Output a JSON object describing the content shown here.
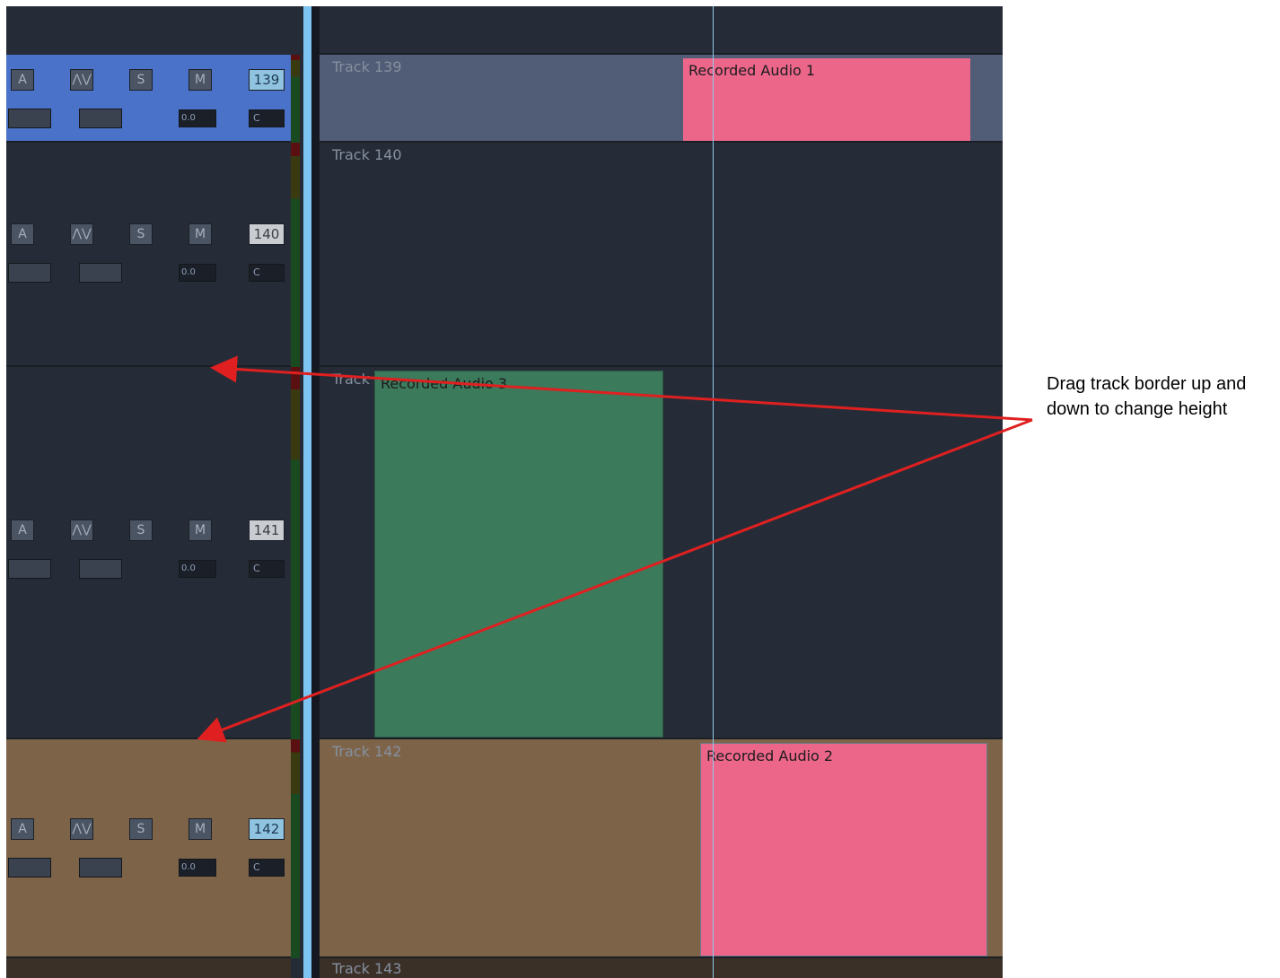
{
  "tracks": [
    {
      "number": "139",
      "label": "Track 139",
      "volume": "0.0",
      "pan": "C",
      "buttons": [
        "A",
        "⋀⋁",
        "S",
        "M"
      ]
    },
    {
      "number": "140",
      "label": "Track 140",
      "volume": "0.0",
      "pan": "C",
      "buttons": [
        "A",
        "⋀⋁",
        "S",
        "M"
      ]
    },
    {
      "number": "141",
      "label": "Track",
      "volume": "0.0",
      "pan": "C",
      "buttons": [
        "A",
        "⋀⋁",
        "S",
        "M"
      ]
    },
    {
      "number": "142",
      "label": "Track 142",
      "volume": "0.0",
      "pan": "C",
      "buttons": [
        "A",
        "⋀⋁",
        "S",
        "M"
      ]
    },
    {
      "number": "143",
      "label": "Track 143"
    }
  ],
  "clips": [
    {
      "name": "Recorded Audio 1",
      "color": "#ec668a"
    },
    {
      "name": "Recorded Audio 3",
      "color": "#3c7a5c"
    },
    {
      "name": "Recorded Audio 2",
      "color": "#ec668a"
    }
  ],
  "annotation": {
    "text": "Drag track border up and down to change height",
    "arrow_color": "#e02020"
  },
  "colors": {
    "track_139": "#4a72c8",
    "track_142": "#7d6449",
    "lane_139": "#515c76",
    "lane_142": "#7d6449",
    "background": "#262c37",
    "divider": "#7dc4f2"
  }
}
